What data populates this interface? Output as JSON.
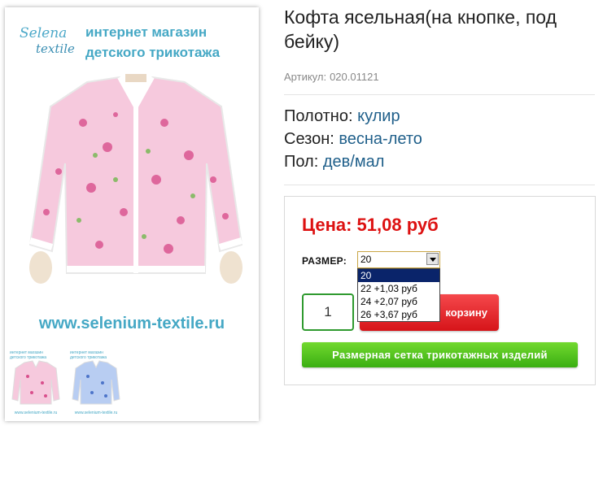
{
  "gallery": {
    "main_image": {
      "logo_line1": "Selena",
      "logo_line2": "textile",
      "header_line1": "интернет магазин",
      "header_line2": "детского трикотажа",
      "url": "www.selenium-textile.ru",
      "garment_color": "#f6c9dd",
      "print_color": "#d94f8c"
    },
    "thumbnails": [
      {
        "line1": "интернет магазин",
        "line2": "детского трикотажа",
        "url": "www.selenium-textile.ru",
        "color": "#f6c9dd",
        "print_color": "#d94f8c"
      },
      {
        "line1": "интернет магазин",
        "line2": "детского трикотажа",
        "url": "www.selenium-textile.ru",
        "color": "#b8cdf2",
        "print_color": "#4c74c9"
      }
    ]
  },
  "product": {
    "title": "Кофта ясельная(на кнопке, под бейку)",
    "sku_label": "Артикул:",
    "sku_value": "020.01121",
    "properties": [
      {
        "label": "Полотно:",
        "value": "кулир"
      },
      {
        "label": "Сезон:",
        "value": "весна-лето"
      },
      {
        "label": "Пол:",
        "value": "дев/мал"
      }
    ]
  },
  "buy": {
    "price_text": "Цена: 51,08 руб",
    "size_label": "РАЗМЕР:",
    "size_selected": "20",
    "size_options": [
      "20",
      "22 +1,03 руб",
      "24 +2,07 руб",
      "26 +3,67 руб"
    ],
    "quantity": "1",
    "cart_button_label": "корзину",
    "size_chart_button_label": "Размерная сетка трикотажных изделий"
  },
  "colors": {
    "accent_blue": "#45a8c5",
    "price_red": "#dd1111",
    "link_blue": "#1f5f8a",
    "cart_red": "#e8262b",
    "size_chart_green": "#4ec41c"
  }
}
